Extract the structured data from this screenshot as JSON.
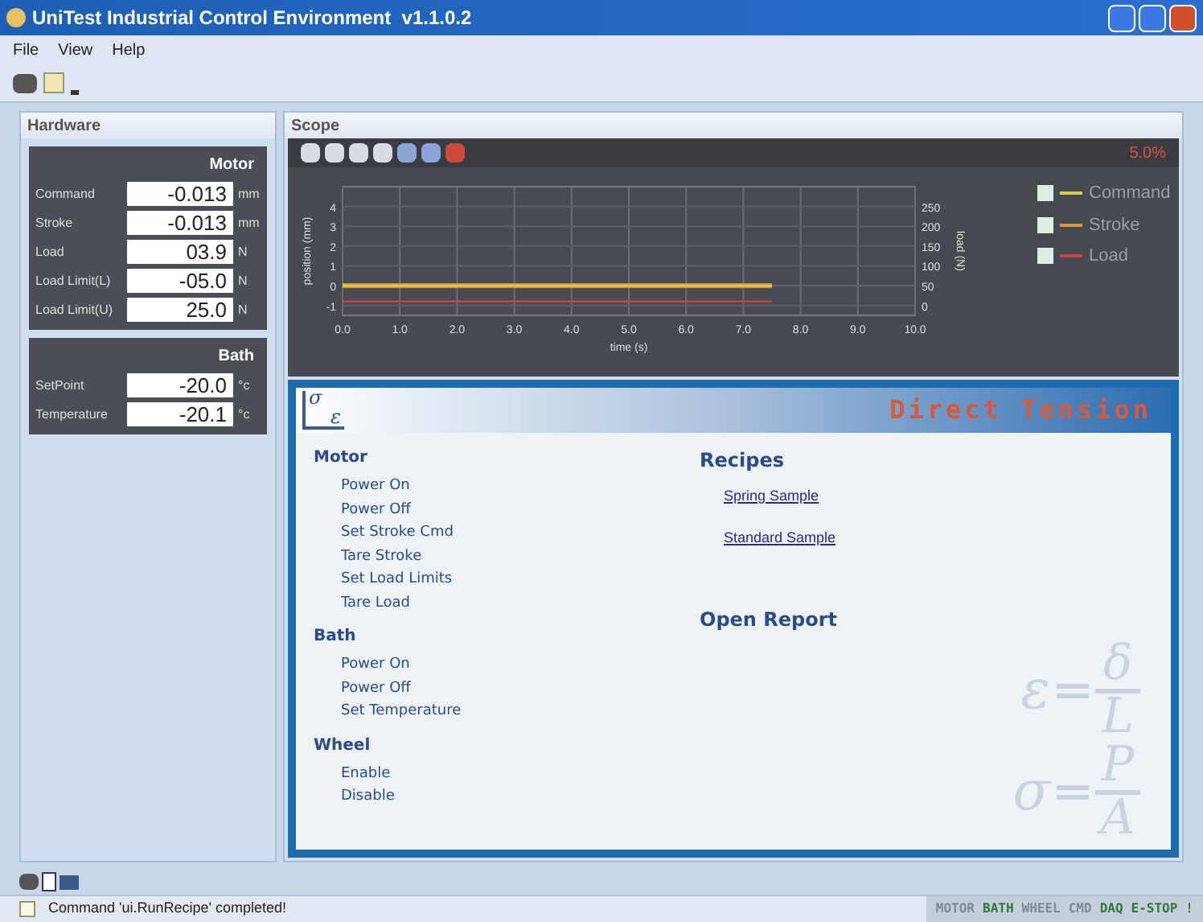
{
  "window": {
    "title": "UniTest Industrial Control Environment  v1.1.0.2"
  },
  "menu": [
    "File",
    "View",
    "Help"
  ],
  "hardware": {
    "title": "Hardware",
    "groups": [
      {
        "title": "Motor",
        "fields": [
          {
            "label": "Command",
            "value": "-0.013",
            "unit": "mm"
          },
          {
            "label": "Stroke",
            "value": "-0.013",
            "unit": "mm"
          },
          {
            "label": "Load",
            "value": "03.9",
            "unit": "N"
          },
          {
            "label": "Load Limit(L)",
            "value": "-05.0",
            "unit": "N"
          },
          {
            "label": "Load Limit(U)",
            "value": "25.0",
            "unit": "N"
          }
        ]
      },
      {
        "title": "Bath",
        "fields": [
          {
            "label": "SetPoint",
            "value": "-20.0",
            "unit": "°c"
          },
          {
            "label": "Temperature",
            "value": "-20.1",
            "unit": "°c"
          }
        ]
      }
    ]
  },
  "scope": {
    "title": "Scope",
    "reading": "5.0%",
    "legend": [
      {
        "checked": true
      },
      {
        "checked": true
      },
      {
        "checked": true
      }
    ],
    "chart_data": {
      "type": "line",
      "xlabel": "time (s)",
      "ylabel": "position (mm)",
      "y2label": "load (N)",
      "x": [
        0,
        7.5
      ],
      "series": [
        {
          "name": "Command",
          "color": "#d8d040",
          "values": [
            0,
            0
          ]
        },
        {
          "name": "Stroke",
          "color": "#e09040",
          "values": [
            0,
            0
          ]
        },
        {
          "name": "Load",
          "color": "#d04040",
          "values": [
            -0.8,
            -0.8
          ]
        }
      ],
      "xlim": [
        0,
        10
      ],
      "ylim": [
        -1.5,
        5
      ],
      "xticks": [
        {
          "value": 0,
          "label": "0.0"
        },
        {
          "value": 1,
          "label": "1.0"
        },
        {
          "value": 2,
          "label": "2.0"
        },
        {
          "value": 3,
          "label": "3.0"
        },
        {
          "value": 4,
          "label": "4.0"
        },
        {
          "value": 5,
          "label": "5.0"
        },
        {
          "value": 6,
          "label": "6.0"
        },
        {
          "value": 7,
          "label": "7.0"
        },
        {
          "value": 8,
          "label": "8.0"
        },
        {
          "value": 9,
          "label": "9.0"
        },
        {
          "value": 10,
          "label": "10.0"
        }
      ],
      "yticks": [
        -1,
        0,
        1,
        2,
        3,
        4
      ],
      "grid": true,
      "y2lim": [
        -25,
        300
      ],
      "y2ticks": [
        0,
        50,
        100,
        150,
        200,
        250
      ]
    }
  },
  "recipe_panel": {
    "logo": {
      "top": "σ",
      "bottom": "ε"
    },
    "title": "Direct Tension",
    "sections": [
      {
        "title": "Motor",
        "items": [
          "Power On",
          "Power Off",
          "Set Stroke Cmd",
          "Tare Stroke",
          "Set Load Limits",
          "Tare Load"
        ]
      },
      {
        "title": "Bath",
        "items": [
          "Power On",
          "Power Off",
          "Set Temperature"
        ]
      },
      {
        "title": "Wheel",
        "items": [
          "Enable",
          "Disable"
        ]
      }
    ],
    "recipes": {
      "title": "Recipes",
      "links": [
        "Spring Sample",
        "Standard Sample"
      ]
    },
    "open_report": "Open Report",
    "formulas": [
      {
        "lhs": "ε",
        "num": "δ",
        "den": "L"
      },
      {
        "lhs": "σ",
        "num": "P",
        "den": "A"
      }
    ]
  },
  "status_bar": {
    "message": "Command 'ui.RunRecipe' completed!",
    "indicators": [
      {
        "label": "MOTOR",
        "on": false
      },
      {
        "label": "BATH",
        "on": true
      },
      {
        "label": "WHEEL",
        "on": false
      },
      {
        "label": "CMD",
        "on": false
      },
      {
        "label": "DAQ",
        "on": true
      },
      {
        "label": "E-STOP",
        "on": true
      },
      {
        "label": "!",
        "on": true
      }
    ]
  }
}
